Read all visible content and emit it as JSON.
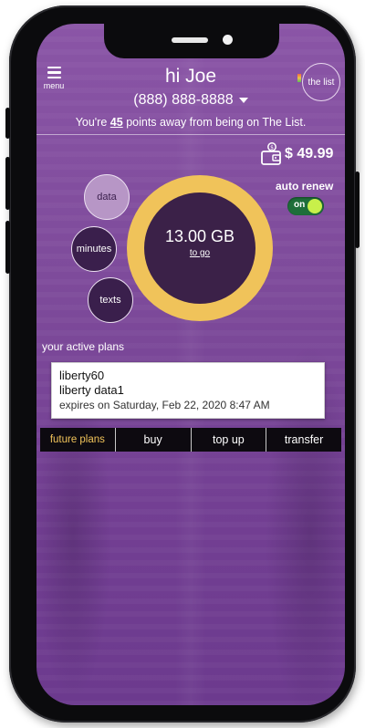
{
  "header": {
    "menu_label": "menu",
    "greeting": "hi Joe",
    "phone_number": "(888) 888-8888",
    "the_list_label": "the list",
    "points_prefix": "You're",
    "points_value": "45",
    "points_suffix": "points away from being on The List."
  },
  "account": {
    "balance": "$ 49.99",
    "auto_renew_label": "auto renew",
    "auto_renew_state": "on",
    "accent_color": "#f0c35a",
    "toggle_color": "#1e6e3a"
  },
  "usage": {
    "buttons": [
      "data",
      "minutes",
      "texts"
    ],
    "selected": "data",
    "remaining_value": "13.00 GB",
    "remaining_label": "to go"
  },
  "plans": {
    "title": "your active plans",
    "lines": [
      "liberty60",
      "liberty data1"
    ],
    "expiry": "expires on Saturday, Feb 22, 2020 8:47 AM"
  },
  "tabs": [
    "future plans",
    "buy",
    "top up",
    "transfer"
  ],
  "icons": [
    "menu-icon",
    "caret-down-icon",
    "wallet-icon",
    "the-list-icon"
  ]
}
